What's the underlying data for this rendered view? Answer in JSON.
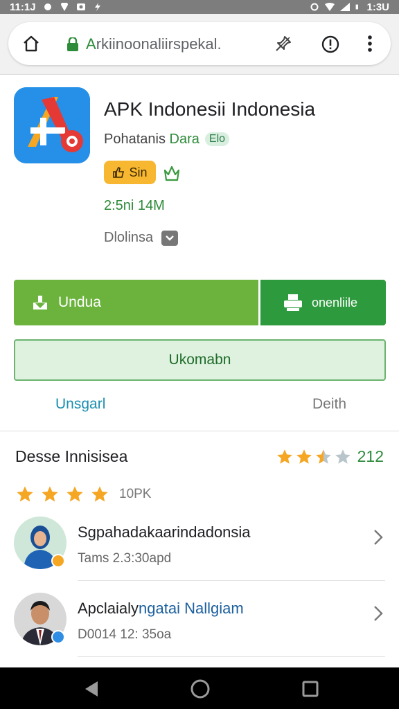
{
  "status_bar": {
    "time": "11:1J",
    "battery": "1:3U"
  },
  "browser": {
    "url_green": "A",
    "url_rest": "rkiinoonaliirspekal."
  },
  "app": {
    "name": "APK Indonesii Indonesia",
    "developer_prefix": "Pohatanis",
    "developer_name": "Dara",
    "developer_badge": "Elo",
    "rating_pill": "Sin",
    "size": "2:5ni 14M",
    "tag": "Dlolinsa"
  },
  "buttons": {
    "download": "Undua",
    "secondary": "onenliile",
    "outline": "Ukomabn"
  },
  "tabs": {
    "left": "Unsgarl",
    "right": "Deith"
  },
  "reviews": {
    "title": "Desse Innisisea",
    "score_count": "212",
    "score_stars": 3.3,
    "filter_stars": 4,
    "filter_count": "10PK",
    "items": [
      {
        "name": "Sgpahadakaarindadonsia",
        "name_highlight": "",
        "time": "Tams 2.3:30apd",
        "badge_color": "#f5a623"
      },
      {
        "name": "Apclaialy",
        "name_highlight": "ngatai Nallgiam",
        "time": "D0014 12: 35oa",
        "badge_color": "#2f8de4"
      }
    ]
  },
  "colors": {
    "accent_green": "#6cb33e",
    "dark_green": "#2e9a3e",
    "star": "#f5a623",
    "link_teal": "#1a8fb0"
  },
  "icons": [
    "home-icon",
    "lock-icon",
    "pin-icon",
    "info-icon",
    "more-icon",
    "download-icon",
    "print-icon",
    "star-icon",
    "chevron-right-icon",
    "back-icon",
    "home-nav-icon",
    "recent-apps-icon"
  ]
}
